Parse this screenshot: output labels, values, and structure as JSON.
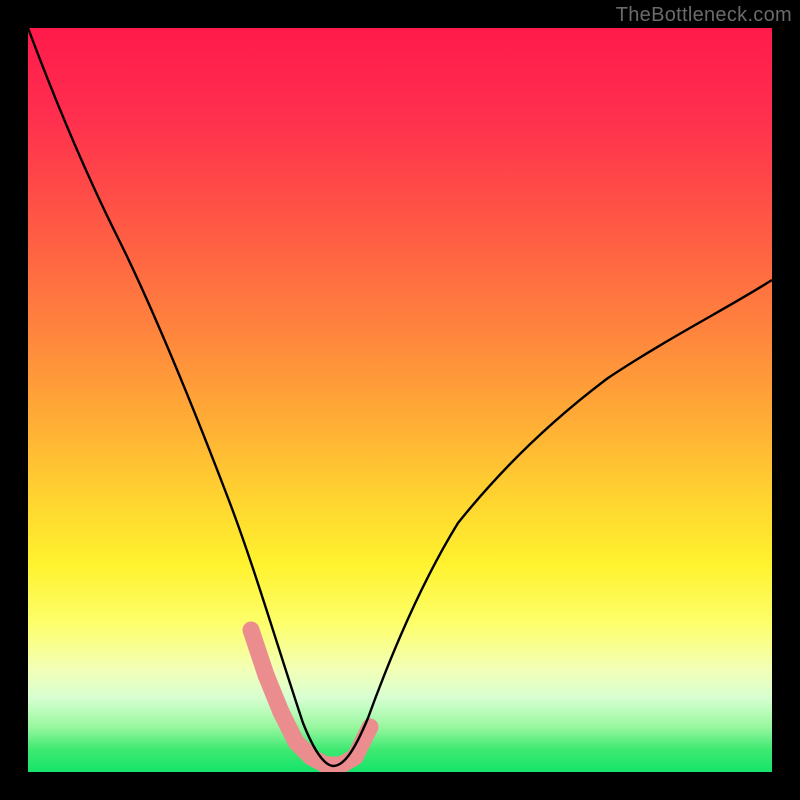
{
  "watermark": "TheBottleneck.com",
  "chart_data": {
    "type": "line",
    "title": "",
    "xlabel": "",
    "ylabel": "",
    "xlim": [
      0,
      100
    ],
    "ylim": [
      0,
      100
    ],
    "series": [
      {
        "name": "main-curve",
        "x": [
          0,
          5,
          10,
          15,
          20,
          25,
          28,
          30,
          32,
          34,
          36,
          38,
          40,
          42,
          44,
          46,
          50,
          55,
          60,
          65,
          70,
          75,
          80,
          85,
          90,
          95,
          100
        ],
        "y": [
          100,
          85,
          72,
          59,
          46,
          33,
          25,
          19,
          13,
          8,
          4,
          2,
          1,
          1,
          2,
          6,
          15,
          25,
          33,
          40,
          46,
          51,
          55,
          59,
          62,
          65,
          67
        ]
      },
      {
        "name": "highlight-band",
        "x": [
          30,
          32,
          34,
          36,
          38,
          40,
          42,
          44,
          46
        ],
        "y": [
          19,
          13,
          8,
          4,
          2,
          1,
          1,
          2,
          6
        ]
      }
    ],
    "gradient_stops": [
      {
        "pos": 1.0,
        "color": "#ff1a4b"
      },
      {
        "pos": 0.72,
        "color": "#fff22e"
      },
      {
        "pos": 0.0,
        "color": "#16e46b"
      }
    ]
  }
}
